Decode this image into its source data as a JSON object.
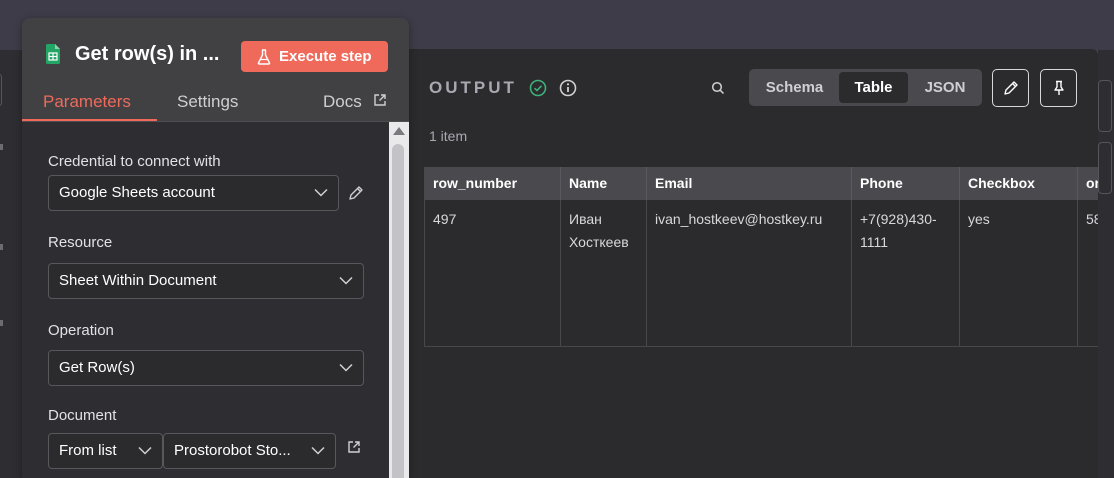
{
  "node": {
    "title": "Get row(s) in ...",
    "execute_label": "Execute step",
    "tabs": [
      {
        "label": "Parameters"
      },
      {
        "label": "Settings"
      },
      {
        "label": "Docs"
      }
    ],
    "fields": {
      "credential": {
        "label": "Credential to connect with",
        "value": "Google Sheets account"
      },
      "resource": {
        "label": "Resource",
        "value": "Sheet Within Document"
      },
      "operation": {
        "label": "Operation",
        "value": "Get Row(s)"
      },
      "document": {
        "label": "Document",
        "mode": "From list",
        "value": "Prostorobot Sto..."
      }
    }
  },
  "output": {
    "title": "OUTPUT",
    "item_count": "1 item",
    "views": [
      {
        "label": "Schema",
        "active": false
      },
      {
        "label": "Table",
        "active": true
      },
      {
        "label": "JSON",
        "active": false
      }
    ],
    "table": {
      "columns": [
        "row_number",
        "Name",
        "Email",
        "Phone",
        "Checkbox",
        "or"
      ],
      "rows": [
        [
          "497",
          "Иван Хосткеев",
          "ivan_hostkeev@hostkey.ru",
          "+7(928)430-1111",
          "yes",
          "58"
        ]
      ]
    }
  },
  "icons": [
    "google-sheets-icon",
    "flask-icon",
    "external-link-icon",
    "chevron-down-icon",
    "pencil-icon",
    "check-circle-icon",
    "info-icon",
    "search-icon",
    "pin-icon"
  ],
  "colors": {
    "accent": "#ef6a5b",
    "success": "#3fb07a",
    "panel": "#2b2b2e"
  }
}
